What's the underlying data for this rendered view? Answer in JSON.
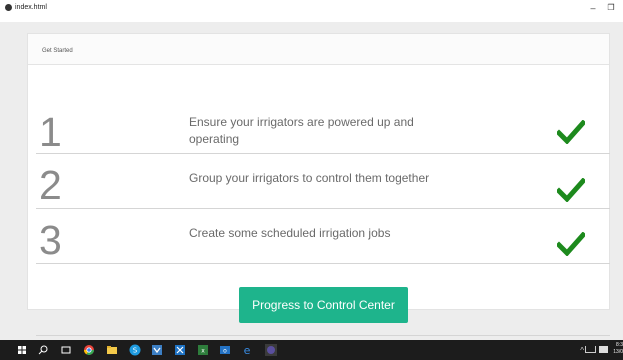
{
  "window": {
    "title": "index.html",
    "minimize_glyph": "–",
    "restore_glyph": "❐"
  },
  "card": {
    "header": "Get Started",
    "steps": [
      {
        "number": "1",
        "text": "Ensure your irrigators are powered up and operating",
        "status_icon": "checkmark-icon"
      },
      {
        "number": "2",
        "text": "Group your irrigators to control them together",
        "status_icon": "checkmark-icon"
      },
      {
        "number": "3",
        "text": "Create some scheduled irrigation jobs",
        "status_icon": "checkmark-icon"
      }
    ],
    "cta_label": "Progress to Control Center"
  },
  "colors": {
    "check": "#1d8a1d",
    "cta_background": "#1eb48c",
    "cta_text": "#ffffff",
    "taskbar": "#1c1c1c"
  },
  "taskbar": {
    "icons": [
      "start-icon",
      "search-icon",
      "task-view-icon",
      "chrome-icon",
      "file-explorer-icon",
      "skype-icon",
      "vs-code-icon",
      "visual-studio-icon",
      "excel-icon",
      "outlook-icon",
      "edge-icon",
      "app-icon"
    ],
    "clock_time": "8:3",
    "clock_date": "13/0"
  }
}
